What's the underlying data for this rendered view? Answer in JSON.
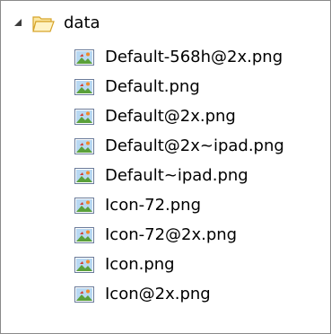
{
  "tree": {
    "folder": {
      "label": "data",
      "expanded": true,
      "icon": "folder-open-icon",
      "twisty_icon": "expanded-triangle-icon"
    },
    "files": [
      {
        "label": "Default-568h@2x.png",
        "icon": "image-file-icon"
      },
      {
        "label": "Default.png",
        "icon": "image-file-icon"
      },
      {
        "label": "Default@2x.png",
        "icon": "image-file-icon"
      },
      {
        "label": "Default@2x~ipad.png",
        "icon": "image-file-icon"
      },
      {
        "label": "Default~ipad.png",
        "icon": "image-file-icon"
      },
      {
        "label": "Icon-72.png",
        "icon": "image-file-icon"
      },
      {
        "label": "Icon-72@2x.png",
        "icon": "image-file-icon"
      },
      {
        "label": "Icon.png",
        "icon": "image-file-icon"
      },
      {
        "label": "Icon@2x.png",
        "icon": "image-file-icon"
      }
    ]
  },
  "colors": {
    "panel_border": "#8a8a8a",
    "folder_fill": "#fde9a4",
    "folder_stroke": "#d9a72a",
    "twisty": "#3c3c3c"
  }
}
